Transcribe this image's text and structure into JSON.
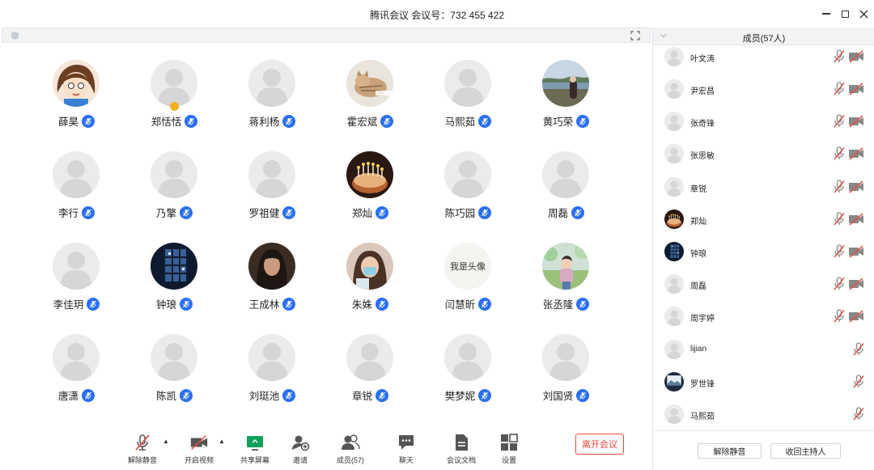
{
  "window": {
    "title": "腾讯会议  会议号：732 455 422"
  },
  "participants": [
    {
      "name": "薛昊",
      "avatar": "cartoon-girl"
    },
    {
      "name": "郑恬恬",
      "avatar": "default",
      "host": true
    },
    {
      "name": "蒋利杨",
      "avatar": "default"
    },
    {
      "name": "霍宏斌",
      "avatar": "cat-photo"
    },
    {
      "name": "马熙茹",
      "avatar": "default"
    },
    {
      "name": "黄巧荣",
      "avatar": "seaside-photo"
    },
    {
      "name": "李行",
      "avatar": "default"
    },
    {
      "name": "乃擎",
      "avatar": "default"
    },
    {
      "name": "罗祖健",
      "avatar": "default"
    },
    {
      "name": "郑灿",
      "avatar": "cake-photo"
    },
    {
      "name": "陈巧园",
      "avatar": "default"
    },
    {
      "name": "周磊",
      "avatar": "default"
    },
    {
      "name": "李佳玥",
      "avatar": "default"
    },
    {
      "name": "钟琅",
      "avatar": "night-window-photo"
    },
    {
      "name": "王成林",
      "avatar": "portrait-photo"
    },
    {
      "name": "朱姝",
      "avatar": "selfie-photo"
    },
    {
      "name": "闫慧昕",
      "avatar": "text",
      "avatar_text": "我是头像"
    },
    {
      "name": "张丞隆",
      "avatar": "outdoor-photo"
    },
    {
      "name": "唐潇",
      "avatar": "default"
    },
    {
      "name": "陈凯",
      "avatar": "default"
    },
    {
      "name": "刘珽池",
      "avatar": "default"
    },
    {
      "name": "章锐",
      "avatar": "default"
    },
    {
      "name": "樊梦妮",
      "avatar": "default"
    },
    {
      "name": "刘国贤",
      "avatar": "default"
    }
  ],
  "toolbar": {
    "unmute_label": "解除静音",
    "video_label": "开启视频",
    "share_label": "共享屏幕",
    "invite_label": "邀请",
    "members_label": "成员(57)",
    "chat_label": "聊天",
    "docs_label": "会议文档",
    "settings_label": "设置",
    "leave_label": "离开会议"
  },
  "panel": {
    "title": "成员(57人)",
    "members": [
      {
        "name": "叶文涛",
        "avatar": "default",
        "camera": true
      },
      {
        "name": "尹宏昌",
        "avatar": "default",
        "camera": true
      },
      {
        "name": "张奇锋",
        "avatar": "default",
        "camera": true
      },
      {
        "name": "张思敏",
        "avatar": "default",
        "camera": true
      },
      {
        "name": "章锐",
        "avatar": "default",
        "camera": true
      },
      {
        "name": "郑灿",
        "avatar": "cake-photo",
        "camera": true
      },
      {
        "name": "钟琅",
        "avatar": "night-window-photo",
        "camera": true
      },
      {
        "name": "周磊",
        "avatar": "default",
        "camera": true
      },
      {
        "name": "周宇婷",
        "avatar": "default",
        "camera": true
      },
      {
        "name": "lijian",
        "avatar": "default",
        "camera": false
      },
      {
        "name": "罗世锋",
        "avatar": "landscape-photo",
        "camera": false
      },
      {
        "name": "马熙茹",
        "avatar": "default",
        "camera": false
      }
    ],
    "unmute_all_label": "解除静音",
    "reclaim_host_label": "收回主持人"
  },
  "colors": {
    "accent_blue": "#2a6ff3",
    "leave_red": "#e8463c",
    "muted_red": "#e0524a"
  }
}
